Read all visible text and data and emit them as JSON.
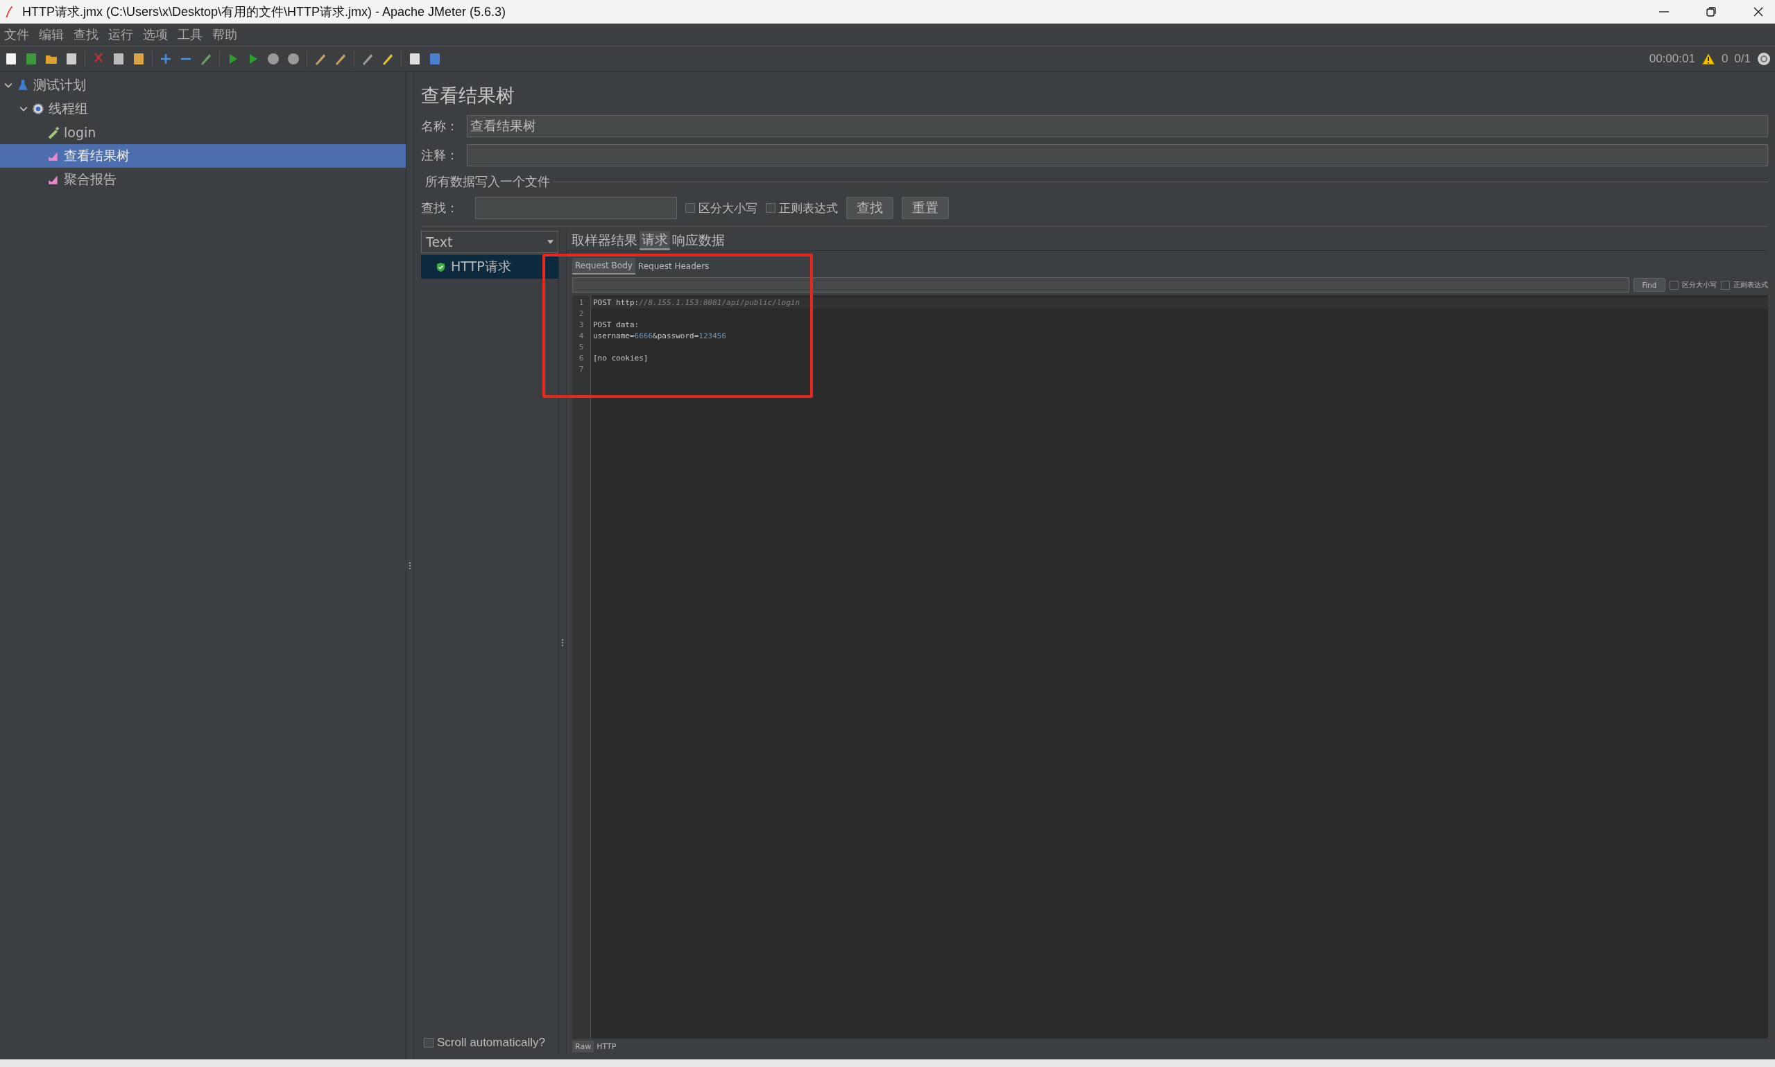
{
  "window": {
    "title": "HTTP请求.jmx (C:\\Users\\x\\Desktop\\有用的文件\\HTTP请求.jmx) - Apache JMeter (5.6.3)"
  },
  "menu": [
    "文件",
    "编辑",
    "查找",
    "运行",
    "选项",
    "工具",
    "帮助"
  ],
  "status": {
    "elapsed": "00:00:01",
    "warnings": "0",
    "threads": "0/1"
  },
  "tree": [
    {
      "label": "测试计划",
      "kind": "plan",
      "expanded": true,
      "selected": false,
      "children": [
        {
          "label": "线程组",
          "kind": "threads",
          "expanded": true,
          "selected": false,
          "children": [
            {
              "label": "login",
              "kind": "sampler",
              "selected": false
            },
            {
              "label": "查看结果树",
              "kind": "listener",
              "selected": true
            },
            {
              "label": "聚合报告",
              "kind": "listener",
              "selected": false
            }
          ]
        }
      ]
    }
  ],
  "panel": {
    "title": "查看结果树",
    "name_label": "名称：",
    "name_value": "查看结果树",
    "comment_label": "注释：",
    "file_group": "所有数据写入一个文件",
    "search_label": "查找：",
    "case_option": {
      "label": "区分大小写",
      "checked": false
    },
    "regex_option": {
      "label": "正则表达式",
      "checked": false
    },
    "buttons": [
      "查找",
      "重置"
    ]
  },
  "results": {
    "renderer": "Text",
    "items": [
      {
        "label": "HTTP请求",
        "selected": true
      }
    ],
    "scroll_auto": {
      "label": "Scroll automatically?",
      "checked": false
    }
  },
  "tabs": [
    {
      "label": "取样器结果",
      "selected": false
    },
    {
      "label": "请求",
      "selected": true
    },
    {
      "label": "响应数据",
      "selected": false
    }
  ],
  "sub_tabs": [
    {
      "label": "Request Body",
      "selected": true
    },
    {
      "label": "Request Headers",
      "selected": false
    }
  ],
  "editor_find": {
    "button": "Find",
    "case_option": {
      "label": "区分大小写",
      "checked": false
    },
    "regex_option": {
      "label": "正则表达式",
      "checked": false
    }
  },
  "code_lines": [
    {
      "number": "1",
      "parts": [
        {
          "text": "POST http:",
          "kind": "plain"
        },
        {
          "text": "//8.155.1.153:8081/api/public/login",
          "kind": "comment"
        }
      ]
    },
    {
      "number": "2"
    },
    {
      "number": "3",
      "parts": [
        {
          "text": "POST data:",
          "kind": "plain"
        }
      ]
    },
    {
      "number": "4",
      "parts": [
        {
          "text": "username=",
          "kind": "plain"
        },
        {
          "text": "6666",
          "kind": "number"
        },
        {
          "text": "&password=",
          "kind": "plain"
        },
        {
          "text": "123456",
          "kind": "number"
        }
      ]
    },
    {
      "number": "5"
    },
    {
      "number": "6",
      "parts": [
        {
          "text": "[no cookies]",
          "kind": "plain"
        }
      ]
    },
    {
      "number": "7"
    }
  ],
  "bottom_tabs": [
    {
      "label": "Raw",
      "selected": true
    },
    {
      "label": "HTTP",
      "selected": false
    }
  ]
}
